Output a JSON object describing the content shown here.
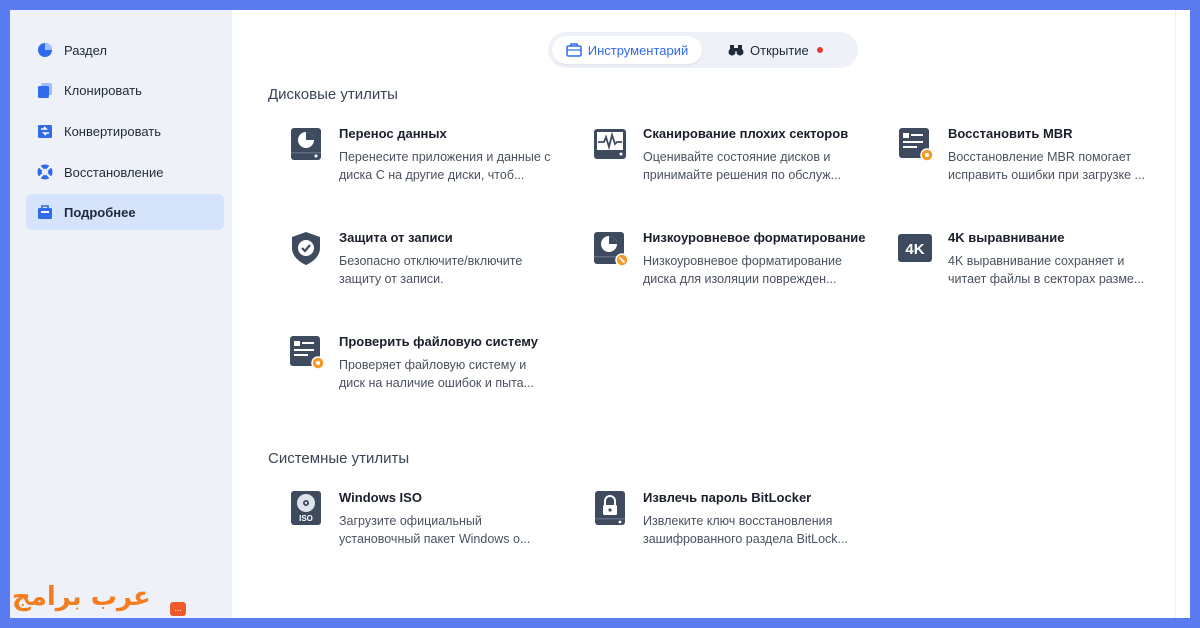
{
  "sidebar": {
    "items": [
      {
        "label": "Раздел",
        "icon": "pie-chart-icon"
      },
      {
        "label": "Клонировать",
        "icon": "clone-icon"
      },
      {
        "label": "Конвертировать",
        "icon": "convert-icon"
      },
      {
        "label": "Восстановление",
        "icon": "lifebuoy-icon"
      },
      {
        "label": "Подробнее",
        "icon": "toolbox-icon",
        "active": true
      }
    ]
  },
  "watermark": {
    "text": "عرب برامج",
    "badge": "..."
  },
  "tabs": [
    {
      "label": "Инструментарий",
      "icon": "briefcase-icon",
      "active": true
    },
    {
      "label": "Открытие",
      "icon": "binoculars-icon",
      "dot": true
    }
  ],
  "sections": {
    "disk": {
      "title": "Дисковые утилиты",
      "cards": [
        {
          "title": "Перенос данных",
          "desc": "Перенесите приложения и данные с диска С на другие диски, чтоб...",
          "icon": "disk-pie-icon"
        },
        {
          "title": "Сканирование плохих секторов",
          "desc": "Оценивайте состояние дисков и принимайте решения по обслуж...",
          "icon": "scan-pulse-icon"
        },
        {
          "title": "Восстановить MBR",
          "desc": "Восстановление MBR помогает исправить ошибки при загрузке ...",
          "icon": "mbr-repair-icon"
        },
        {
          "title": "Защита от записи",
          "desc": "Безопасно отключите/включите защиту от записи.",
          "icon": "shield-check-icon"
        },
        {
          "title": "Низкоуровневое форматирование",
          "desc": "Низкоуровневое форматирование диска для изоляции поврежден...",
          "icon": "disk-format-icon"
        },
        {
          "title": "4K выравнивание",
          "desc": "4K выравнивание сохраняет и читает файлы в секторах разме...",
          "icon": "4k-icon",
          "icon_text": "4K"
        },
        {
          "title": "Проверить файловую систему",
          "desc": "Проверяет файловую систему и диск на наличие ошибок и пыта...",
          "icon": "filesystem-check-icon"
        }
      ]
    },
    "system": {
      "title": "Системные утилиты",
      "cards": [
        {
          "title": "Windows ISO",
          "desc": "Загрузите официальный установочный пакет Windows о...",
          "icon": "iso-disc-icon",
          "icon_text": "ISO"
        },
        {
          "title": "Извлечь пароль BitLocker",
          "desc": "Извлеките ключ восстановления зашифрованного раздела BitLock...",
          "icon": "bitlocker-lock-icon"
        }
      ]
    }
  },
  "colors": {
    "accent": "#2f6bea",
    "icon_dark": "#3e4a5e",
    "orange": "#f49a2a",
    "frame": "#5b7cf0"
  }
}
